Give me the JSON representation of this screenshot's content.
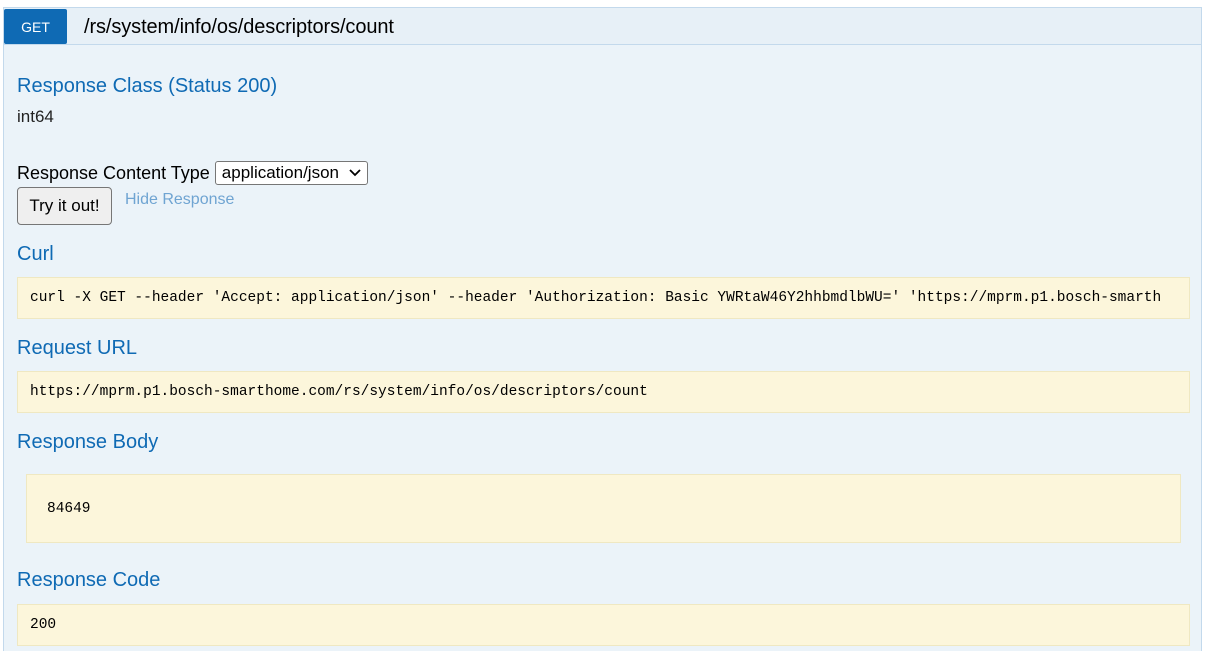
{
  "operation": {
    "method": "GET",
    "path": "/rs/system/info/os/descriptors/count"
  },
  "response_class": {
    "title": "Response Class (Status 200)",
    "type": "int64"
  },
  "content_type": {
    "label": "Response Content Type",
    "selected": "application/json"
  },
  "actions": {
    "try_label": "Try it out!",
    "hide_label": "Hide Response"
  },
  "curl": {
    "title": "Curl",
    "command": "curl -X GET --header 'Accept: application/json' --header 'Authorization: Basic YWRtaW46Y2hhbmdlbWU=' 'https://mprm.p1.bosch-smarth"
  },
  "request_url": {
    "title": "Request URL",
    "value": "https://mprm.p1.bosch-smarthome.com/rs/system/info/os/descriptors/count"
  },
  "response_body": {
    "title": "Response Body",
    "value": "84649"
  },
  "response_code": {
    "title": "Response Code",
    "value": "200"
  }
}
